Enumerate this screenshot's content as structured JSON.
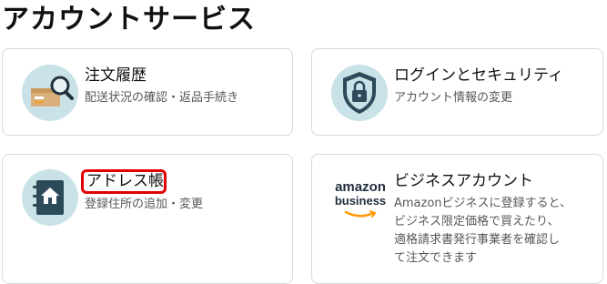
{
  "page": {
    "title": "アカウントサービス"
  },
  "cards": {
    "orders": {
      "title": "注文履歴",
      "subtitle": "配送状況の確認・返品手続き",
      "icon": "package-search-icon"
    },
    "security": {
      "title": "ログインとセキュリティ",
      "subtitle": "アカウント情報の変更",
      "icon": "shield-lock-icon"
    },
    "address": {
      "title": "アドレス帳",
      "subtitle": "登録住所の追加・変更",
      "icon": "address-book-home-icon",
      "highlighted": true
    },
    "business": {
      "title": "ビジネスアカウント",
      "subtitle_lines": [
        "Amazonビジネスに登録すると、",
        "ビジネス限定価格で買えたり、",
        "適格請求書発行事業者を確認し",
        "て注文できます"
      ],
      "logo_line1": "amazon",
      "logo_line2": "business",
      "icon": "amazon-business-logo"
    }
  },
  "colors": {
    "icon_circle": "#c9e2e8",
    "card_border": "#d5d9d9",
    "highlight": "#e00000",
    "subtext": "#565959",
    "amazon_orange": "#ff9900"
  }
}
